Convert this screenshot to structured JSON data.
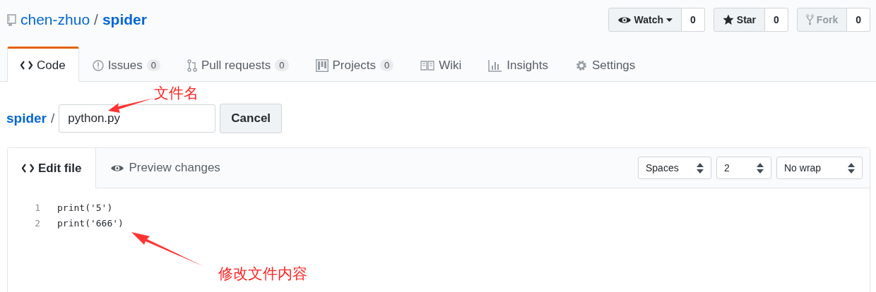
{
  "repo": {
    "owner": "chen-zhuo",
    "separator": "/",
    "name": "spider"
  },
  "actions": [
    {
      "kind": "watch",
      "label": "Watch",
      "count": "0",
      "disabled": false
    },
    {
      "kind": "star",
      "label": "Star",
      "count": "0",
      "disabled": false
    },
    {
      "kind": "fork",
      "label": "Fork",
      "count": "0",
      "disabled": true
    }
  ],
  "tabs": [
    {
      "kind": "code",
      "label": "Code",
      "selected": true
    },
    {
      "kind": "issues",
      "label": "Issues",
      "count": "0",
      "selected": false
    },
    {
      "kind": "pulls",
      "label": "Pull requests",
      "count": "0",
      "selected": false
    },
    {
      "kind": "projects",
      "label": "Projects",
      "count": "0",
      "selected": false
    },
    {
      "kind": "wiki",
      "label": "Wiki",
      "selected": false
    },
    {
      "kind": "insights",
      "label": "Insights",
      "selected": false
    },
    {
      "kind": "settings",
      "label": "Settings",
      "selected": false
    }
  ],
  "filename": {
    "breadcrumb": "spider",
    "separator": "/",
    "value": "python.py",
    "cancel": "Cancel"
  },
  "editor": {
    "tabs": [
      {
        "kind": "edit",
        "label": "Edit file",
        "selected": true
      },
      {
        "kind": "preview",
        "label": "Preview changes",
        "selected": false
      }
    ],
    "selects": [
      "Spaces",
      "2",
      "No wrap"
    ],
    "lines": [
      {
        "number": "1",
        "code": "print('5')"
      },
      {
        "number": "2",
        "code": "print('666')"
      }
    ]
  },
  "annotations": [
    {
      "kind": "filename",
      "text": "文件名"
    },
    {
      "kind": "content",
      "text": "修改文件内容"
    }
  ]
}
